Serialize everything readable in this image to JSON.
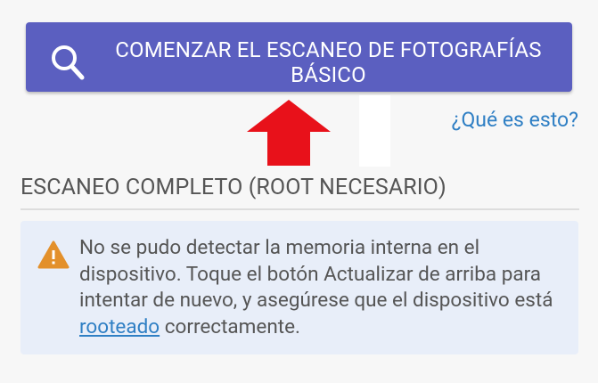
{
  "scan_button": {
    "icon": "search-icon",
    "label": "COMENZAR EL ESCANEO DE FOTOGRAFÍAS BÁSICO"
  },
  "help_link": "¿Qué es esto?",
  "section": {
    "title": "ESCANEO COMPLETO (ROOT NECESARIO)"
  },
  "alert": {
    "icon": "warning-icon",
    "message_before": "No se pudo detectar la memoria interna en el dispositivo. Toque el botón Actualizar de arriba para intentar de nuevo, y asegúrese que el dispositivo está ",
    "link_text": "rooteado",
    "message_after": " correctamente."
  },
  "colors": {
    "button": "#5b5fc0",
    "link": "#2f7fc4",
    "alert_bg": "#e8eef9",
    "warning": "#e3902b",
    "arrow": "#e8111a"
  }
}
